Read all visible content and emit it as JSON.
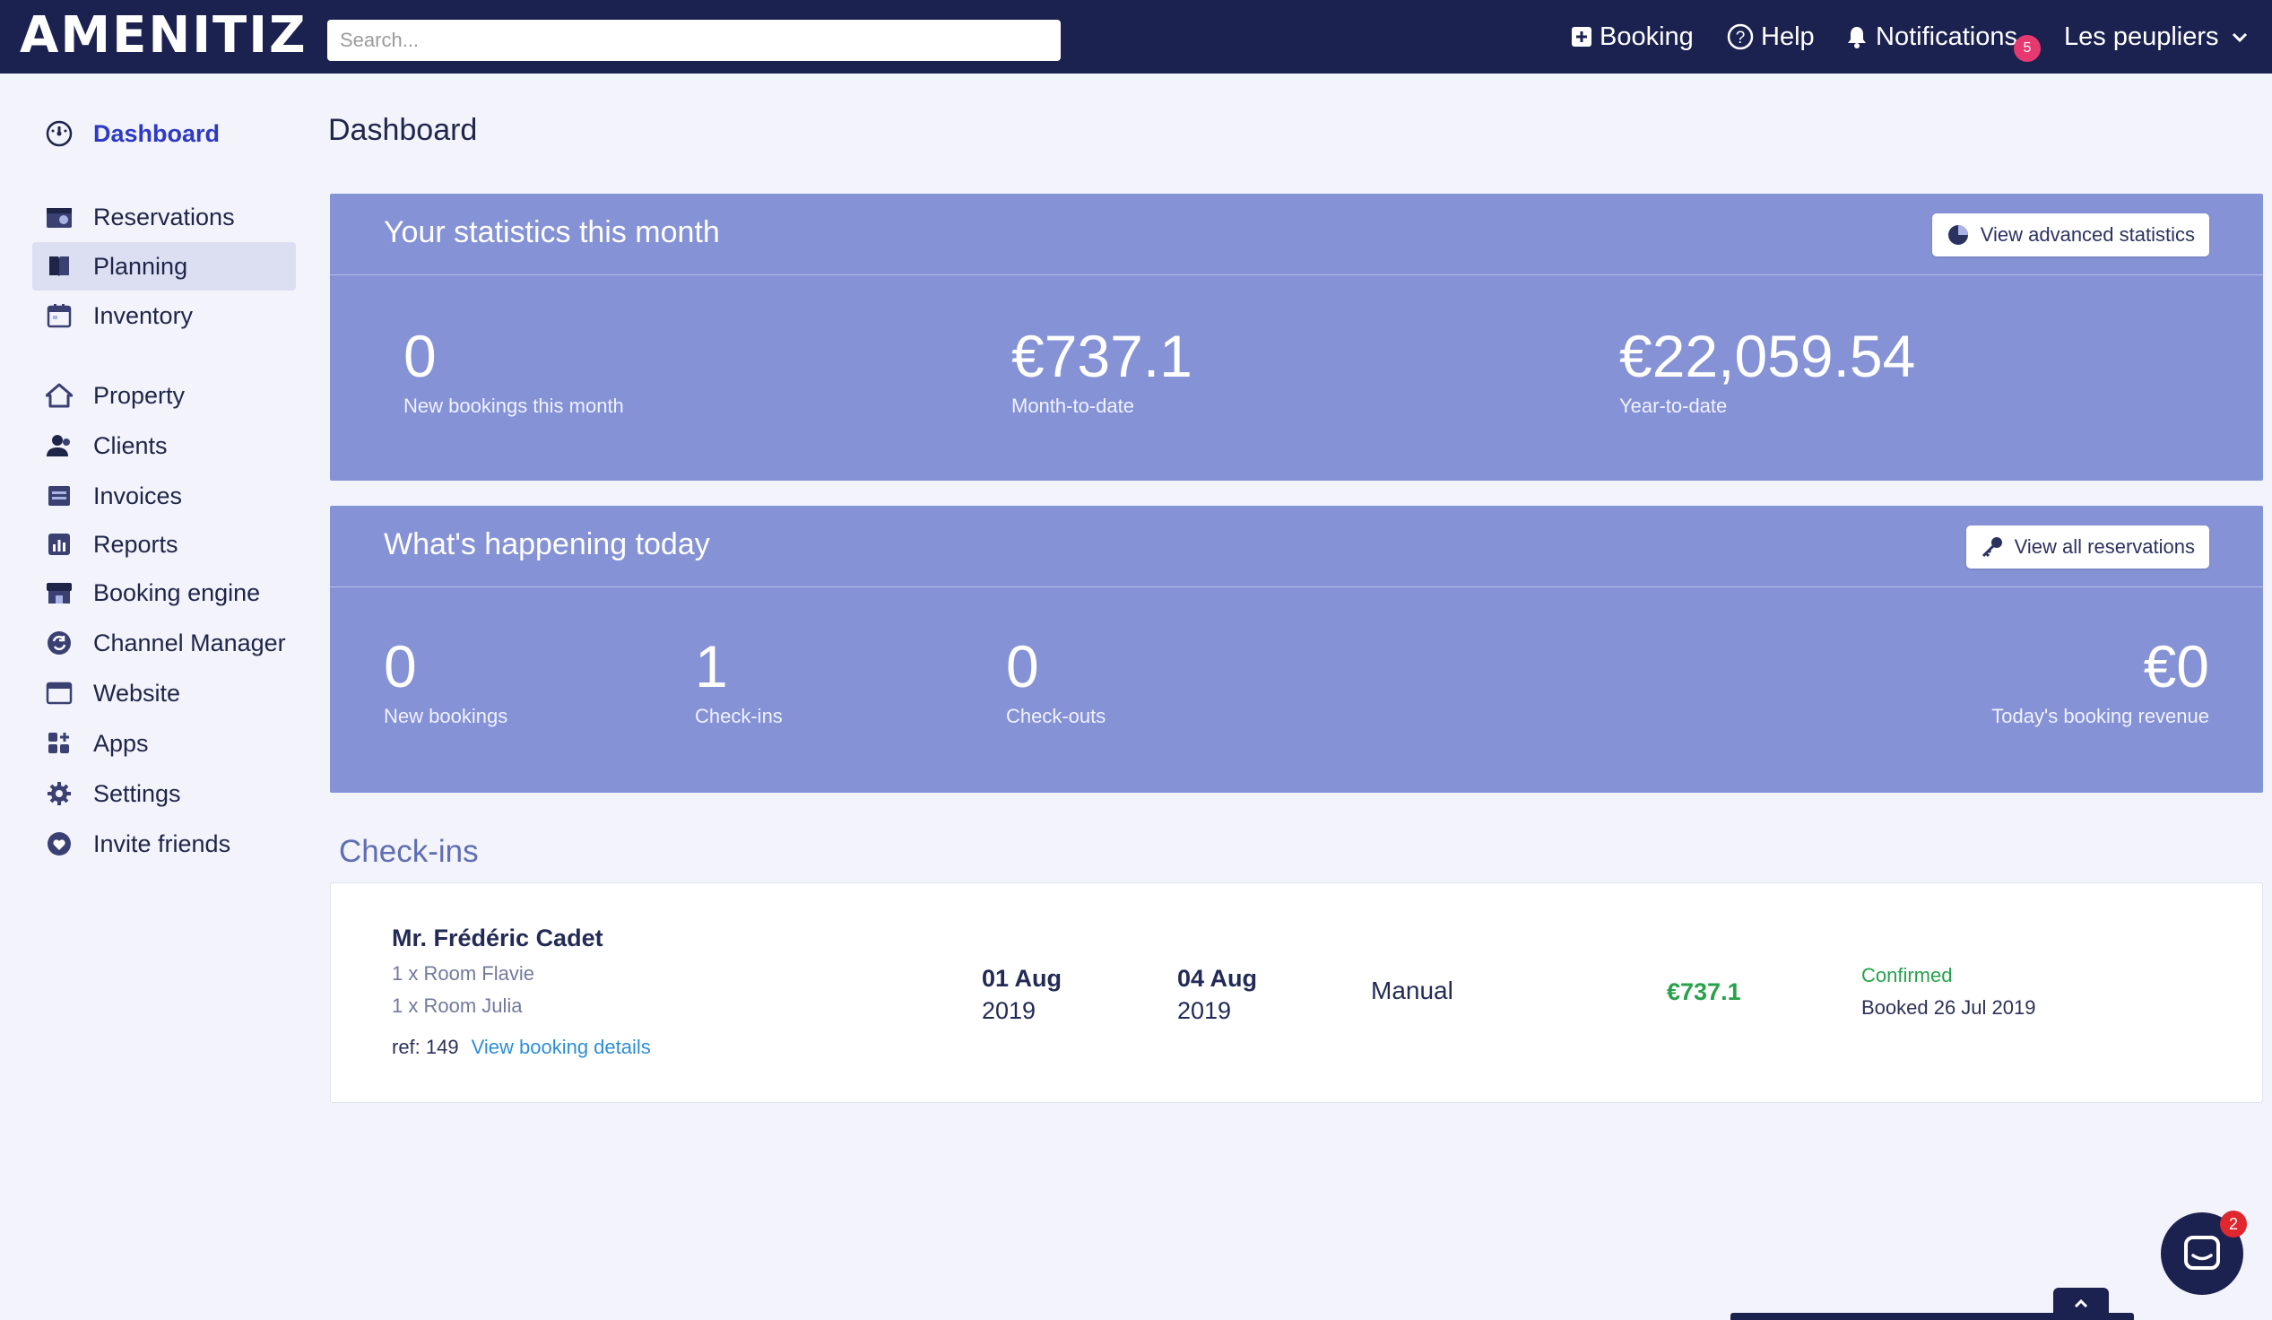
{
  "app": {
    "logo": "AMENITIZ"
  },
  "search": {
    "placeholder": "Search..."
  },
  "topnav": {
    "booking": "Booking",
    "help": "Help",
    "notifications": "Notifications",
    "notifications_count": "5",
    "property_name": "Les peupliers"
  },
  "sidebar": {
    "items": [
      {
        "label": "Dashboard",
        "icon": "dashboard-gauge-icon"
      },
      {
        "label": "Reservations",
        "icon": "reservations-icon"
      },
      {
        "label": "Planning",
        "icon": "planning-book-icon"
      },
      {
        "label": "Inventory",
        "icon": "calendar-icon"
      },
      {
        "label": "Property",
        "icon": "home-icon"
      },
      {
        "label": "Clients",
        "icon": "users-icon"
      },
      {
        "label": "Invoices",
        "icon": "invoice-icon"
      },
      {
        "label": "Reports",
        "icon": "reports-chart-icon"
      },
      {
        "label": "Booking engine",
        "icon": "storefront-icon"
      },
      {
        "label": "Channel Manager",
        "icon": "sync-icon"
      },
      {
        "label": "Website",
        "icon": "browser-window-icon"
      },
      {
        "label": "Apps",
        "icon": "apps-grid-icon"
      },
      {
        "label": "Settings",
        "icon": "gear-icon"
      },
      {
        "label": "Invite friends",
        "icon": "heart-icon"
      }
    ]
  },
  "main": {
    "title": "Dashboard",
    "stats_panel": {
      "title": "Your statistics this month",
      "button": "View advanced statistics",
      "stats": [
        {
          "value": "0",
          "label": "New bookings this month"
        },
        {
          "value": "€737.1",
          "label": "Month-to-date"
        },
        {
          "value": "€22,059.54",
          "label": "Year-to-date"
        }
      ]
    },
    "today_panel": {
      "title": "What's happening today",
      "button": "View all reservations",
      "stats": [
        {
          "value": "0",
          "label": "New bookings"
        },
        {
          "value": "1",
          "label": "Check-ins"
        },
        {
          "value": "0",
          "label": "Check-outs"
        },
        {
          "value": "€0",
          "label": "Today's booking revenue"
        }
      ]
    },
    "checkins": {
      "title": "Check-ins",
      "rows": [
        {
          "guest": "Mr. Frédéric Cadet",
          "rooms": [
            "1 x Room Flavie",
            "1 x Room Julia"
          ],
          "ref_label": "ref: 149",
          "details_link": "View booking details",
          "arrival_day": "01 Aug",
          "arrival_year": "2019",
          "departure_day": "04 Aug",
          "departure_year": "2019",
          "channel": "Manual",
          "amount": "€737.1",
          "status": "Confirmed",
          "booked": "Booked 26 Jul 2019"
        }
      ]
    }
  },
  "chat": {
    "unread": "2"
  },
  "colors": {
    "topbar": "#1c2250",
    "panel": "#8592d5",
    "accent": "#2e3ac4",
    "success": "#27a24a",
    "link": "#2d8ed6",
    "badge": "#e6396f"
  }
}
